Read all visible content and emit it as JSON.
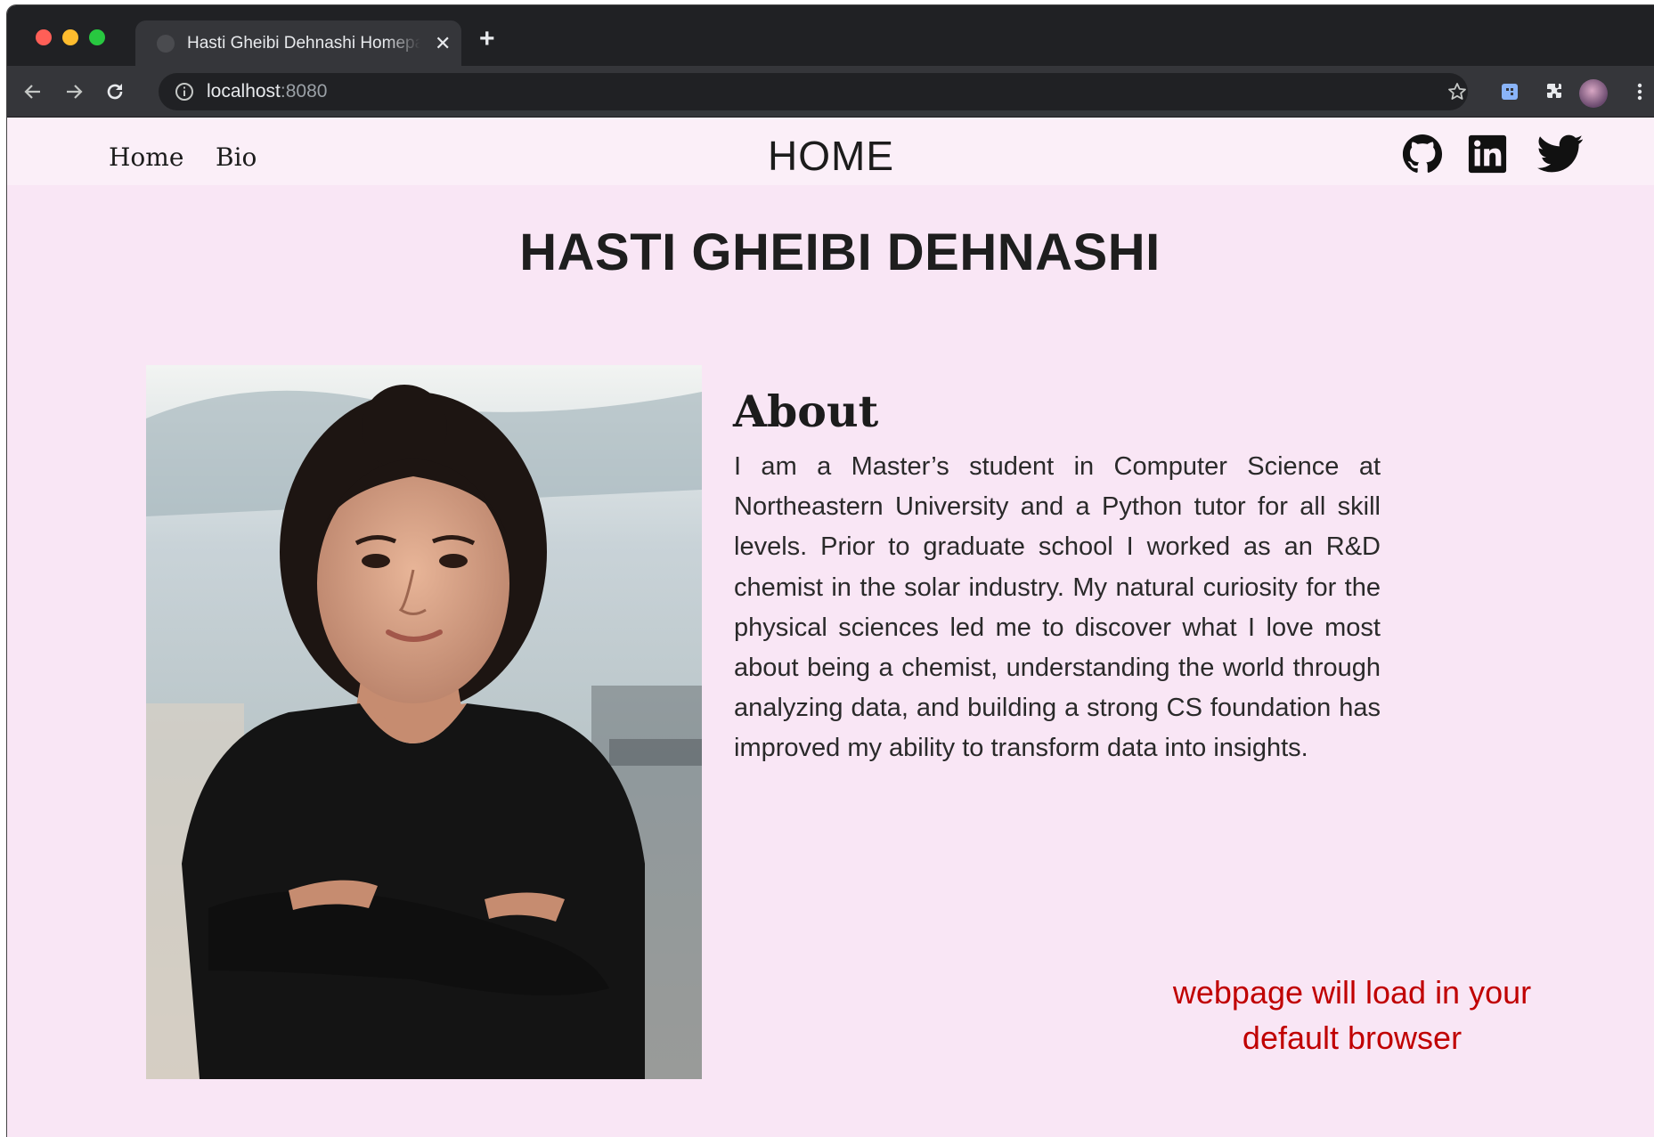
{
  "browser": {
    "tab_title": "Hasti Gheibi Dehnashi Homepage",
    "tab_close": "✕",
    "new_tab": "+",
    "url_host": "localhost",
    "url_port": ":8080"
  },
  "site": {
    "nav": [
      {
        "label": "Home"
      },
      {
        "label": "Bio"
      }
    ],
    "page_heading": "HOME",
    "social": [
      "github-icon",
      "linkedin-icon",
      "twitter-icon"
    ]
  },
  "main": {
    "name": "HASTI GHEIBI DEHNASHI",
    "about_title": "About",
    "about_text": "I am a Master’s student in Computer Science at Northeastern University and a Python tutor for all skill levels. Prior to graduate school I worked as an R&D chemist in the solar industry. My natural curiosity for the physical sciences led me to discover what I love most about being a chemist, understanding the world through analyzing data, and building a strong CS foundation has improved my ability to transform data into insights."
  },
  "notice": {
    "line1": "webpage will load in your",
    "line2": "default browser"
  },
  "colors": {
    "page_bg": "#f9e6f5",
    "nav_bg": "#fbeff8",
    "notice": "#c00000"
  }
}
